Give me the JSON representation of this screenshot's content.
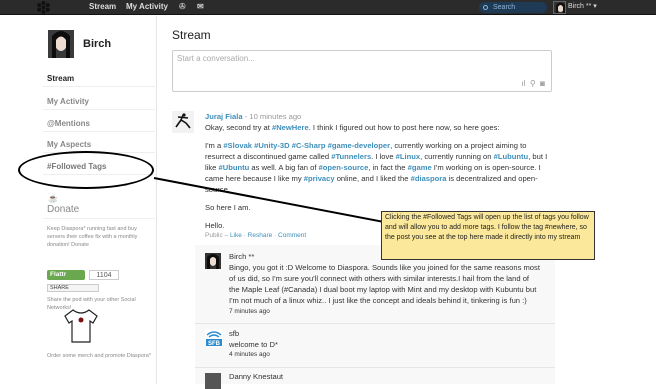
{
  "topbar": {
    "stream_label": "Stream",
    "activity_label": "My Activity",
    "search_placeholder": "Search",
    "user_name": "Birch ** ▾"
  },
  "sidebar": {
    "name": "Birch",
    "items": [
      {
        "label": "Stream",
        "active": true
      },
      {
        "label": "My Activity"
      },
      {
        "label": "@Mentions"
      },
      {
        "label": "My Aspects"
      },
      {
        "label": "#Followed Tags"
      }
    ],
    "donate_title": "Donate",
    "donate_text": "Keep Diaspora* running fast and buy servers their coffee fix with a monthly donation! Donate",
    "flattr_label": "Flattr",
    "flattr_count": "1104",
    "share_label": "SHARE",
    "share_text": "Share the pod with your other Social Networks!",
    "merch_text": "Order some merch and promote Diaspora*"
  },
  "main": {
    "title": "Stream",
    "composer_placeholder": "Start a conversation..."
  },
  "post": {
    "author": "Juraj Fiala",
    "time": "- 10 minutes ago",
    "line1_a": "Okay, second try at ",
    "line1_tag": "#NewHere",
    "line1_b": ". I think I figured out how to post here now, so here goes:",
    "p2_a": "I'm a ",
    "p2_t1": "#Slovak",
    "p2_t2": "#Unity-3D",
    "p2_t3": "#C-Sharp",
    "p2_t4": "#game-developer",
    "p2_b": ", currently working on a project aiming to",
    "p2_line2_a": "resurrect a discontinued game called ",
    "p2_t5": "#Tunnelers",
    "p2_line2_b": ". I love ",
    "p2_t6": "#Linux",
    "p2_line2_c": ", currently running on ",
    "p2_t7": "#Lubuntu",
    "p2_line2_d": ", but I",
    "p2_line3_a": "like ",
    "p2_t8": "#Ubuntu",
    "p2_line3_b": " as well. A big fan of ",
    "p2_t9": "#open-source",
    "p2_line3_c": ", in fact the ",
    "p2_t10": "#game",
    "p2_line3_d": " I'm working on is open-source. I",
    "p2_line4_a": "came here because I like my ",
    "p2_t11": "#privacy",
    "p2_line4_b": " online, and I liked the ",
    "p2_t12": "#diaspora",
    "p2_line4_c": " is decentralized and open-",
    "p2_line5": "source.",
    "p3": "So here I am.",
    "p4": "Hello.",
    "actions_public": "Public – ",
    "actions_like": "Like",
    "actions_reshare": "Reshare",
    "actions_comment": "Comment",
    "actions_sep": " · "
  },
  "comments": [
    {
      "author": "Birch **",
      "lines": [
        "Bingo, you got it :D Welcome to Diaspora. Sounds like you joined for the same reasons most",
        "of us did, so I'm sure you'll connect with others with similar interests.I hail from the land of",
        "the Maple Leaf (#Canada) I dual boot my laptop with Mint and my desktop with Kubuntu but",
        "I'm not much of a linux whiz.. I just like the concept and ideals behind it, tinkering is fun :)"
      ],
      "time": "7 minutes ago"
    },
    {
      "author": "sfb",
      "lines": [
        "welcome to D*"
      ],
      "time": "4 minutes ago"
    },
    {
      "author": "Danny Knestaut",
      "lines": [],
      "time": ""
    }
  ],
  "callout": {
    "text": "Clicking the #Followed Tags will open up the list of tags you follow and will allow you to add more tags. I follow the tag #newhere, so the post you see at the top here made it directly into my stream"
  },
  "colors": {
    "topbar": "#2b2b2b",
    "link": "#3f8fba",
    "callout": "#fbe89a"
  }
}
